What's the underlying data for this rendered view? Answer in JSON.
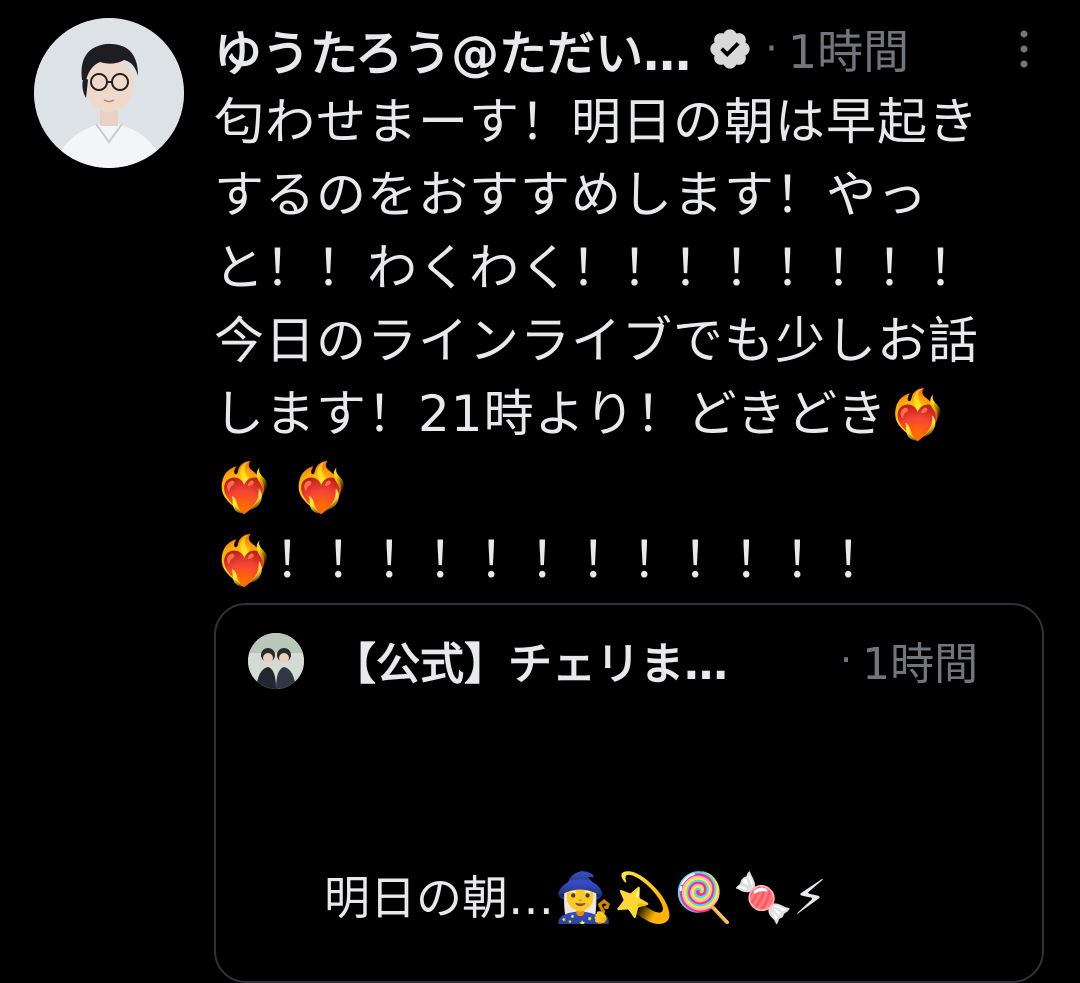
{
  "tweet": {
    "display_name": "ゆうたろう@ただい…",
    "verified_icon": "verified-badge-icon",
    "separator": "·",
    "timestamp": "1時間",
    "more_icon": "vertical-ellipsis-icon",
    "lines": [
      "匂わせまーす！明日の朝は早起き",
      "するのをおすすめします！やっ",
      "と！！わくわく！！！！！！！！",
      "今日のラインライブでも少しお話",
      "します！21時より！どきどき"
    ],
    "line5_emoji": "❤️‍🔥",
    "line6_emojis": "❤️‍🔥 ❤️‍🔥",
    "line7_emoji": "❤️‍🔥",
    "line7_text": "！！！！！！！！！！！！"
  },
  "quote": {
    "display_name": "【公式】チェリま…",
    "separator": "·",
    "timestamp": "1時間",
    "text": "明日の朝…",
    "emojis": "🧙‍♀️💫🍭🍬⚡"
  },
  "colors": {
    "background": "#000000",
    "text_primary": "#e7e9ea",
    "text_secondary": "#71767b",
    "border": "#2f3336"
  }
}
